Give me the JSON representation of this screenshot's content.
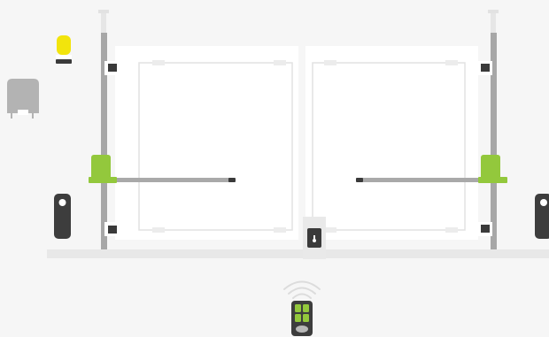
{
  "diagram": {
    "components": [
      {
        "id": "warning-lamp",
        "label": "",
        "color": "#f2e40c"
      },
      {
        "id": "control-unit",
        "label": "",
        "color": "#b3b3b3"
      },
      {
        "id": "left-gate-leaf",
        "label": ""
      },
      {
        "id": "right-gate-leaf",
        "label": ""
      },
      {
        "id": "left-gate-opener",
        "label": "",
        "color": "#93c83c"
      },
      {
        "id": "right-gate-opener",
        "label": "",
        "color": "#93c83c"
      },
      {
        "id": "left-photocell",
        "label": "",
        "color": "#3d3d3d"
      },
      {
        "id": "right-photocell",
        "label": "",
        "color": "#3d3d3d"
      },
      {
        "id": "ground-stop-with-lock",
        "label": ""
      },
      {
        "id": "remote-control",
        "label": "",
        "color": "#93c83c"
      }
    ],
    "icons": {
      "lock": "key-hole-icon",
      "signal": "wireless-signal-icon"
    },
    "palette": {
      "background": "#f6f6f6",
      "gate_fill": "#ffffff",
      "gate_outline": "#e2e2e2",
      "post": "#a7a7a7",
      "ground": "#e8e8e8",
      "accent_green": "#93c83c",
      "dark": "#3d3d3d"
    }
  }
}
